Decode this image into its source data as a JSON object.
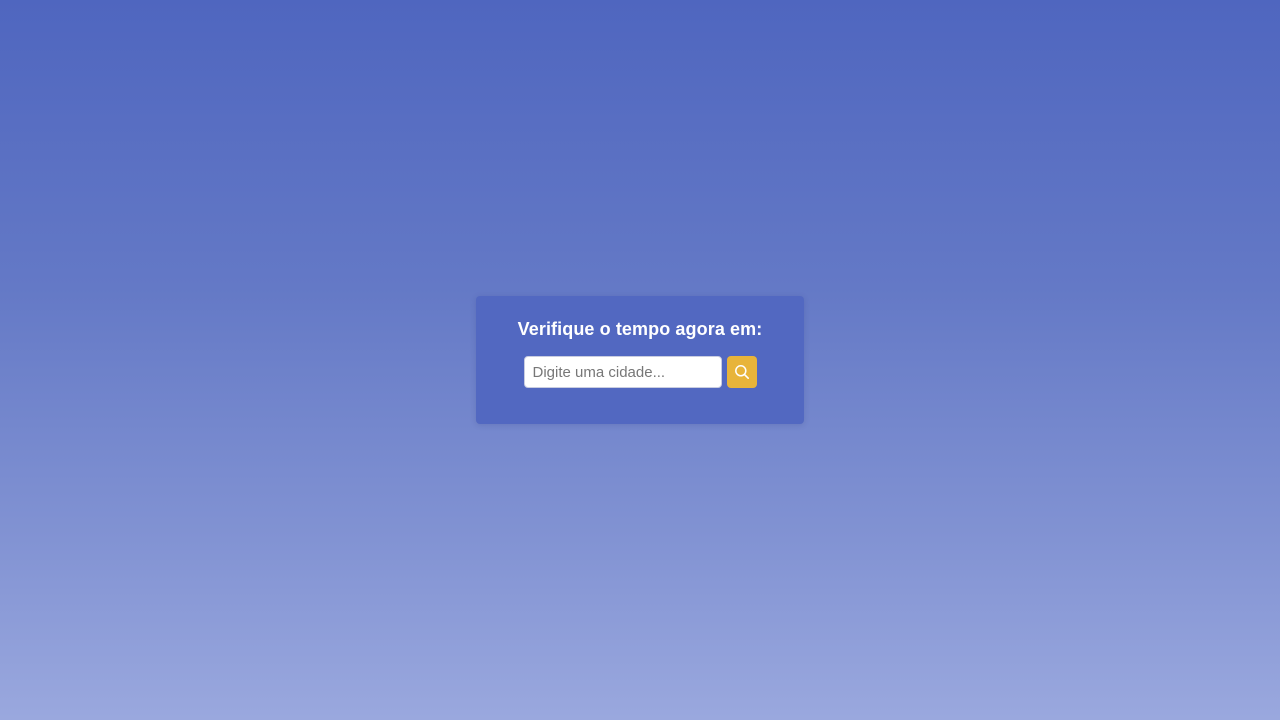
{
  "search_card": {
    "title": "Verifique o tempo agora em:",
    "input": {
      "placeholder": "Digite uma cidade...",
      "value": ""
    },
    "button": {
      "icon": "search-icon",
      "color": "#e8b43a"
    }
  },
  "colors": {
    "background_top": "#4f66bf",
    "background_bottom": "#9aa8de",
    "card": "#5268c1"
  }
}
